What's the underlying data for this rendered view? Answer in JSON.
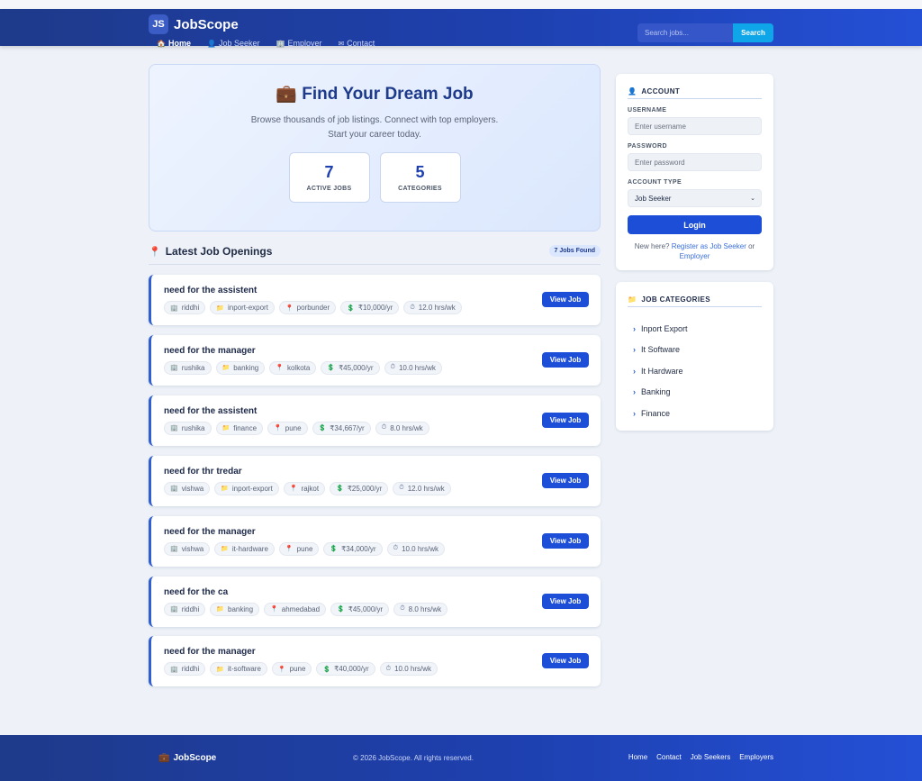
{
  "header": {
    "logo_text": "JS",
    "brand": "JobScope",
    "nav": [
      {
        "icon": "🏠",
        "label": "Home"
      },
      {
        "icon": "👤",
        "label": "Job Seeker"
      },
      {
        "icon": "🏢",
        "label": "Employer"
      },
      {
        "icon": "✉",
        "label": "Contact"
      }
    ],
    "search_placeholder": "Search jobs...",
    "search_button": "Search"
  },
  "hero": {
    "icon": "💼",
    "title": "Find Your Dream Job",
    "subtitle_line1": "Browse thousands of job listings. Connect with top employers.",
    "subtitle_line2": "Start your career today.",
    "stats": [
      {
        "value": "7",
        "label": "ACTIVE JOBS"
      },
      {
        "value": "5",
        "label": "CATEGORIES"
      }
    ]
  },
  "jobs_section": {
    "title": "Latest Job Openings",
    "count": "7 Jobs Found",
    "view_label": "View Job",
    "jobs": [
      {
        "title": "need for the assistent",
        "employer": "riddhi",
        "category": "inport-export",
        "location": "porbunder",
        "salary": "₹10,000/yr",
        "hours": "12.0 hrs/wk"
      },
      {
        "title": "need for the manager",
        "employer": "rushika",
        "category": "banking",
        "location": "kolkota",
        "salary": "₹45,000/yr",
        "hours": "10.0 hrs/wk"
      },
      {
        "title": "need for the assistent",
        "employer": "rushika",
        "category": "finance",
        "location": "pune",
        "salary": "₹34,667/yr",
        "hours": "8.0 hrs/wk"
      },
      {
        "title": "need for thr tredar",
        "employer": "vishwa",
        "category": "inport-export",
        "location": "rajkot",
        "salary": "₹25,000/yr",
        "hours": "12.0 hrs/wk"
      },
      {
        "title": "need for the manager",
        "employer": "vishwa",
        "category": "it-hardware",
        "location": "pune",
        "salary": "₹34,000/yr",
        "hours": "10.0 hrs/wk"
      },
      {
        "title": "need for the ca",
        "employer": "riddhi",
        "category": "banking",
        "location": "ahmedabad",
        "salary": "₹45,000/yr",
        "hours": "8.0 hrs/wk"
      },
      {
        "title": "need for the manager",
        "employer": "riddhi",
        "category": "it-software",
        "location": "pune",
        "salary": "₹40,000/yr",
        "hours": "10.0 hrs/wk"
      }
    ]
  },
  "account": {
    "title": "ACCOUNT",
    "username_label": "USERNAME",
    "username_placeholder": "Enter username",
    "password_label": "PASSWORD",
    "password_placeholder": "Enter password",
    "type_label": "ACCOUNT TYPE",
    "type_value": "Job Seeker",
    "login_button": "Login",
    "register_prefix": "New here?",
    "register_seeker": "Register as Job Seeker",
    "register_or": "or",
    "register_employer": "Employer"
  },
  "categories": {
    "title": "JOB CATEGORIES",
    "items": [
      "Inport Export",
      "It Software",
      "It Hardware",
      "Banking",
      "Finance"
    ]
  },
  "footer": {
    "icon": "💼",
    "brand": "JobScope",
    "copyright": "© 2026 JobScope. All rights reserved.",
    "links": [
      "Home",
      "Contact",
      "Job Seekers",
      "Employers"
    ]
  }
}
